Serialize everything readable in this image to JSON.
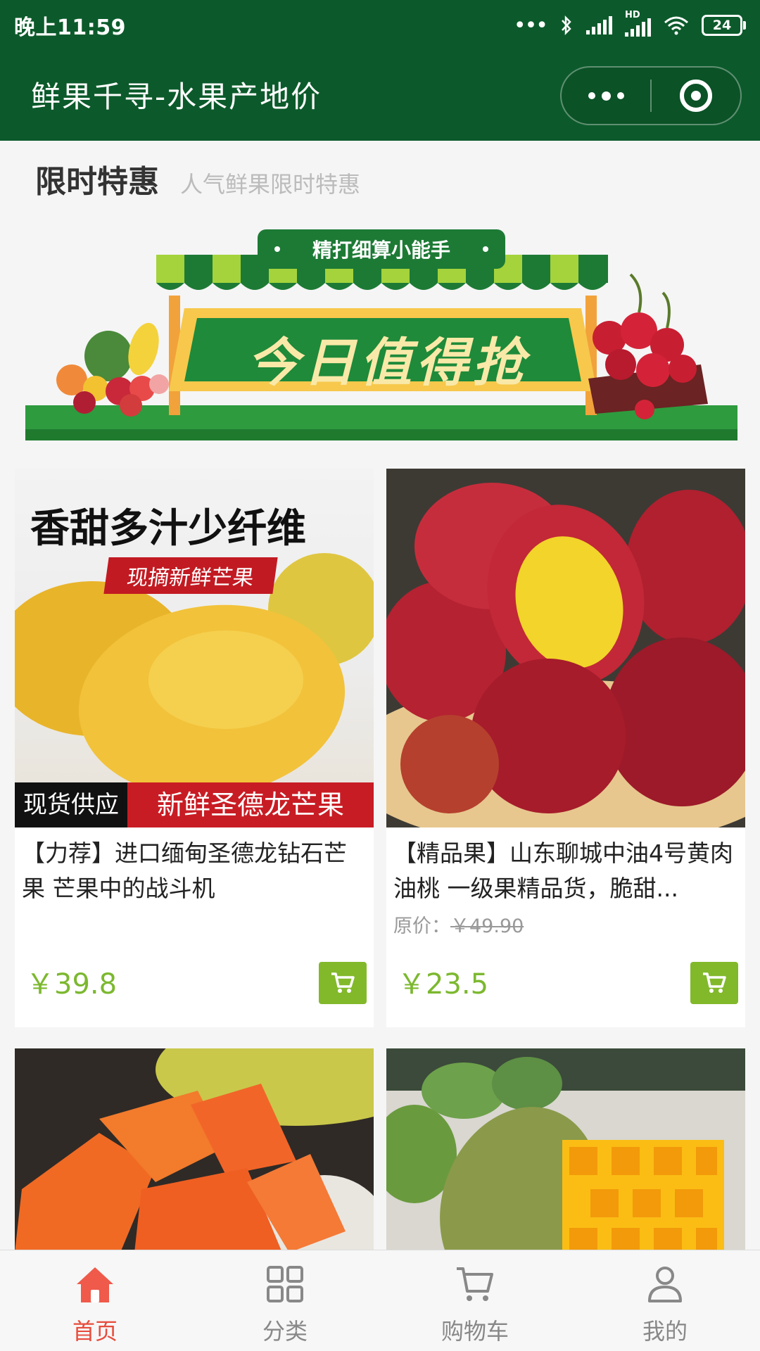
{
  "status_bar": {
    "time": "晚上11:59",
    "hd_label": "HD",
    "battery": "24"
  },
  "header": {
    "title": "鲜果千寻-水果产地价",
    "theme_color": "#0c5a2b"
  },
  "section": {
    "title": "限时特惠",
    "subtitle": "人气鲜果限时特惠"
  },
  "banner": {
    "ribbon": "精打细算小能手",
    "headline": "今日值得抢"
  },
  "products": [
    {
      "image_headline": "香甜多汁少纤维",
      "image_tag": "现摘新鲜芒果",
      "image_label_left": "现货供应",
      "image_label_right": "新鲜圣德龙芒果",
      "name": "【力荐】进口缅甸圣德龙钻石芒果 芒果中的战斗机",
      "original_price": "",
      "price": "￥39.8"
    },
    {
      "name": "【精品果】山东聊城中油4号黄肉油桃 一级果精品货，脆甜...",
      "original_price_label": "原价：",
      "original_price": "￥49.90",
      "price": "￥23.5"
    }
  ],
  "tabbar": {
    "items": [
      {
        "label": "首页",
        "icon": "home-icon",
        "active": true
      },
      {
        "label": "分类",
        "icon": "grid-icon",
        "active": false
      },
      {
        "label": "购物车",
        "icon": "cart-icon",
        "active": false
      },
      {
        "label": "我的",
        "icon": "user-icon",
        "active": false
      }
    ]
  },
  "colors": {
    "accent_green": "#7cb82f",
    "active_tab": "#e74c3c",
    "header_green": "#0c5a2b"
  }
}
